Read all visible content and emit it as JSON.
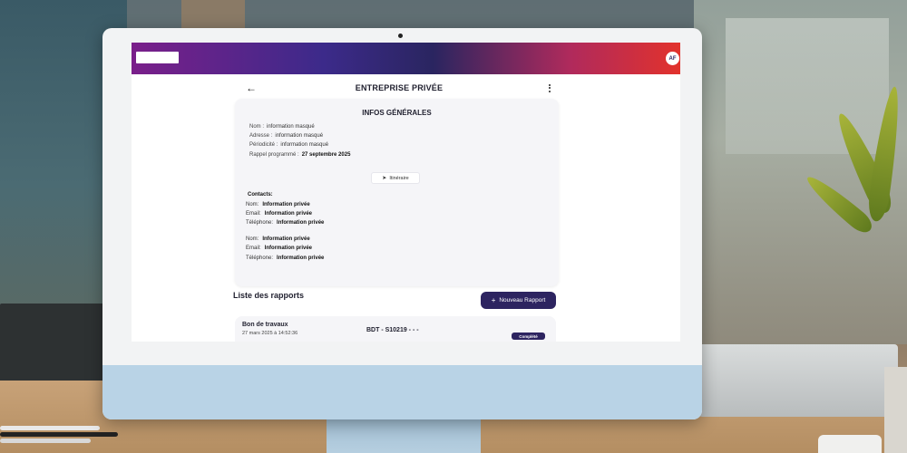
{
  "app": {
    "avatar_initials": "AF",
    "accent_color": "#2d2460"
  },
  "header": {
    "title": "ENTREPRISE PRIVÉE"
  },
  "infos": {
    "title": "INFOS GÉNÉRALES",
    "fields": [
      {
        "label": "Nom :",
        "value": "information masqué"
      },
      {
        "label": "Adresse :",
        "value": "information masqué"
      },
      {
        "label": "Périodicité :",
        "value": "information masqué"
      },
      {
        "label": "Rappel programmé :",
        "value": "27 septembre 2025"
      }
    ],
    "itinerary_label": "Itinéraire"
  },
  "contacts": {
    "title": "Contacts:",
    "entries": [
      {
        "nom_label": "Nom:",
        "nom": "Information privée",
        "email_label": "Email:",
        "email": "Information privée",
        "tel_label": "Téléphone:",
        "tel": "Information privée"
      },
      {
        "nom_label": "Nom:",
        "nom": "Information privée",
        "email_label": "Email:",
        "email": "Information privée",
        "tel_label": "Téléphone:",
        "tel": "Information privée"
      }
    ]
  },
  "reports": {
    "title": "Liste des rapports",
    "new_button_label": "Nouveau Rapport",
    "items": [
      {
        "name": "Bon de travaux",
        "date": "27 mars 2025 à 14:52:36",
        "code": "BDT - S10219 - - -",
        "status": "Complété"
      }
    ]
  }
}
